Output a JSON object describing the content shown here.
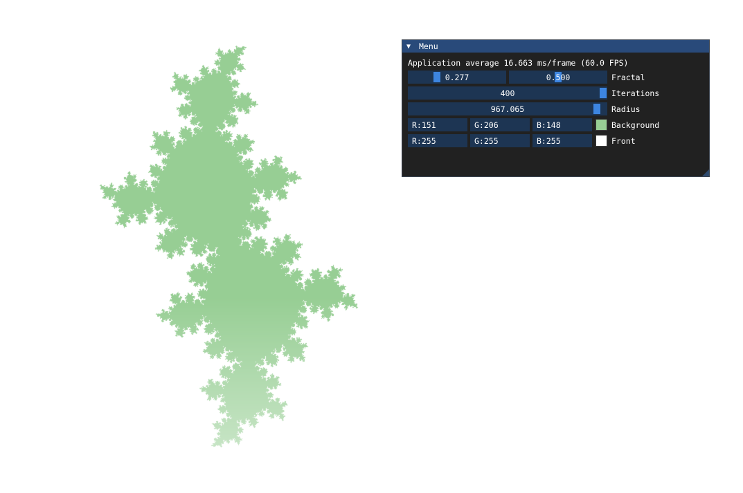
{
  "colors": {
    "fractal_fill": "#97ce94",
    "fractal_light": "#cde6cb",
    "menu_bg": "#1a1a1a",
    "title_bg": "#294a7a",
    "field_bg": "#1d3553",
    "grab": "#3d85e0"
  },
  "menu": {
    "arrow_icon": "collapse-triangle-icon",
    "arrow_glyph": "▼",
    "title": "Menu",
    "stats": "Application average 16.663 ms/frame (60.0 FPS)",
    "fractal": {
      "label": "Fractal",
      "real": {
        "text": "0.277",
        "value": 0.277
      },
      "imag": {
        "text": "0.500",
        "value": 0.5
      }
    },
    "iterations": {
      "label": "Iterations",
      "text": "400",
      "value_fraction": 1.0
    },
    "radius": {
      "label": "Radius",
      "text": "967.065",
      "value_fraction": 0.967
    },
    "background": {
      "label": "Background",
      "r": "R:151",
      "g": "G:206",
      "b": "B:148",
      "swatch": "#97ce94"
    },
    "front": {
      "label": "Front",
      "r": "R:255",
      "g": "G:255",
      "b": "B:255",
      "swatch": "#ffffff"
    }
  }
}
